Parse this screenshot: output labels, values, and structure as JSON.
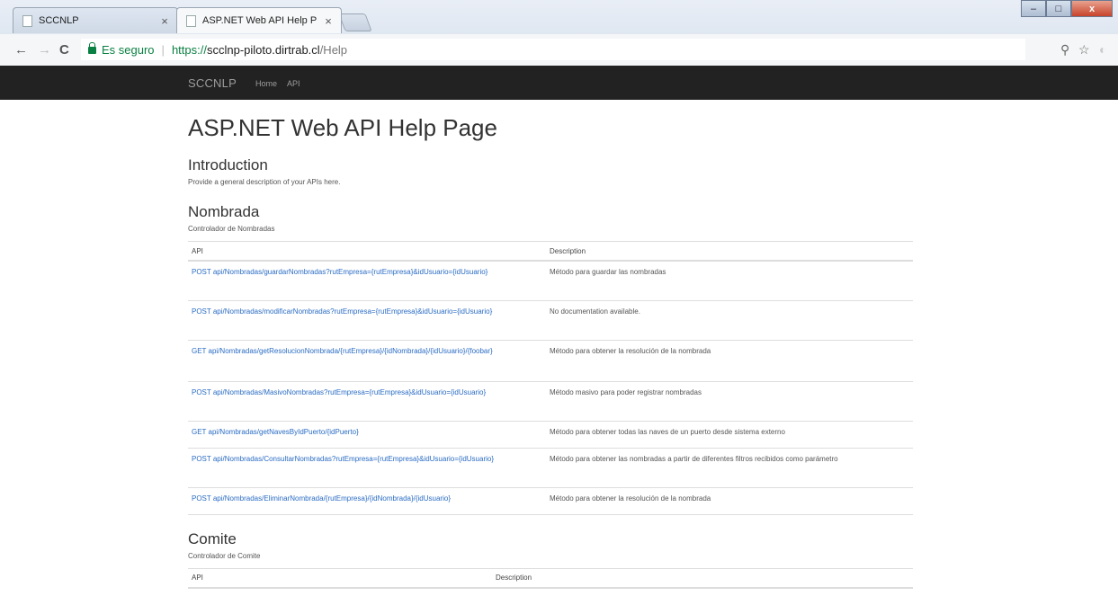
{
  "browser": {
    "tabs": [
      {
        "title": "SCCNLP",
        "close": "×"
      },
      {
        "title": "ASP.NET Web API Help P",
        "close": "×"
      }
    ],
    "window_controls": {
      "minimize": "–",
      "maximize": "□",
      "close": "x"
    },
    "nav": {
      "back": "←",
      "forward": "→",
      "reload": "C"
    },
    "security_label": "Es seguro",
    "url": {
      "scheme": "https://",
      "host": "scclnp-piloto.dirtrab.cl",
      "path": "/Help"
    }
  },
  "navbar": {
    "brand": "SCCNLP",
    "links": [
      "Home",
      "API"
    ]
  },
  "page": {
    "title": "ASP.NET Web API Help Page",
    "intro_heading": "Introduction",
    "intro_text": "Provide a general description of your APIs here."
  },
  "sections": [
    {
      "heading": "Nombrada",
      "subtitle": "Controlador de Nombradas",
      "col_api": "API",
      "col_desc": "Description",
      "rows": [
        {
          "api": "POST api/Nombradas/guardarNombradas?rutEmpresa={rutEmpresa}&idUsuario={idUsuario}",
          "desc": "Método para guardar las nombradas"
        },
        {
          "api": "POST api/Nombradas/modificarNombradas?rutEmpresa={rutEmpresa}&idUsuario={idUsuario}",
          "desc": "No documentation available."
        },
        {
          "api": "GET api/Nombradas/getResolucionNombrada/{rutEmpresa}/{idNombrada}/{idUsuario}/{foobar}",
          "desc": "Método para obtener la resolución de la nombrada"
        },
        {
          "api": "POST api/Nombradas/MasivoNombradas?rutEmpresa={rutEmpresa}&idUsuario={idUsuario}",
          "desc": "Método masivo para poder registrar nombradas"
        },
        {
          "api": "GET api/Nombradas/getNavesByIdPuerto/{idPuerto}",
          "desc": "Método para obtener todas las naves de un puerto desde sistema externo"
        },
        {
          "api": "POST api/Nombradas/ConsultarNombradas?rutEmpresa={rutEmpresa}&idUsuario={idUsuario}",
          "desc": "Método para obtener las nombradas a partir de diferentes filtros recibidos como parámetro"
        },
        {
          "api": "POST api/Nombradas/EliminarNombrada/{rutEmpresa}/{idNombrada}/{idUsuario}",
          "desc": "Método para obtener la resolución de la nombrada"
        }
      ]
    },
    {
      "heading": "Comite",
      "subtitle": "Controlador de Comite",
      "col_api": "API",
      "col_desc": "Description",
      "rows": []
    }
  ]
}
